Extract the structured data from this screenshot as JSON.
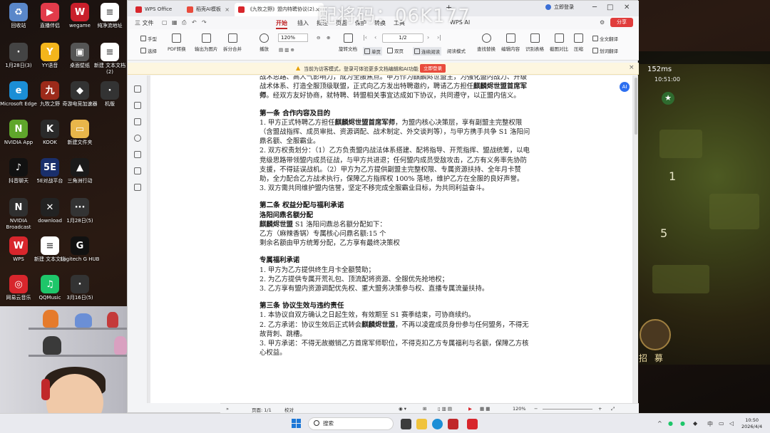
{
  "watermark": "配将码：06K177",
  "desktop_icons": [
    {
      "label": "回收站",
      "glyph": "♻",
      "color": "#5a87c9"
    },
    {
      "label": "直播伴侣",
      "glyph": "▶",
      "color": "#e23b4a"
    },
    {
      "label": "wegame",
      "glyph": "W",
      "color": "#c91f2b"
    },
    {
      "label": "纯净流地址",
      "glyph": "≡",
      "color": "#ffffff"
    },
    {
      "label": "1月28日(3)",
      "glyph": "·",
      "color": "#444444"
    },
    {
      "label": "YY语音",
      "glyph": "Y",
      "color": "#f3b51c"
    },
    {
      "label": "桌面壁纸",
      "glyph": "▣",
      "color": "#555555"
    },
    {
      "label": "新建 文本文档 (2)",
      "glyph": "≡",
      "color": "#ffffff"
    },
    {
      "label": "Microsoft Edge",
      "glyph": "e",
      "color": "#1b8ed6"
    },
    {
      "label": "九牧之野",
      "glyph": "九",
      "color": "#9c2a1a"
    },
    {
      "label": "奇游电竞加速器",
      "glyph": "◆",
      "color": "#333333"
    },
    {
      "label": "机版",
      "glyph": "·",
      "color": "#333333"
    },
    {
      "label": "NVIDIA App",
      "glyph": "N",
      "color": "#5fa62b"
    },
    {
      "label": "KOOK",
      "glyph": "K",
      "color": "#2a2a2a"
    },
    {
      "label": "新建文件夹",
      "glyph": "▭",
      "color": "#e9b64a"
    },
    {
      "label": "抖音聊天",
      "glyph": "♪",
      "color": "#111111"
    },
    {
      "label": "5E对战平台",
      "glyph": "5E",
      "color": "#1a2f6b"
    },
    {
      "label": "三角洲行动",
      "glyph": "▲",
      "color": "#1a1a1a"
    },
    {
      "label": "NVIDIA Broadcast",
      "glyph": "N",
      "color": "#2f2f2f"
    },
    {
      "label": "download",
      "glyph": "✕",
      "color": "#222222"
    },
    {
      "label": "1月28日(5)",
      "glyph": "···",
      "color": "#333333"
    },
    {
      "label": "WPS",
      "glyph": "W",
      "color": "#d8262c"
    },
    {
      "label": "新建 文本文档",
      "glyph": "≡",
      "color": "#ffffff"
    },
    {
      "label": "Logitech G HUB",
      "glyph": "G",
      "color": "#111111"
    },
    {
      "label": "网易云音乐",
      "glyph": "◎",
      "color": "#d7262c"
    },
    {
      "label": "QQMusic",
      "glyph": "♫",
      "color": "#1ec66a"
    },
    {
      "label": "3月16日(5)",
      "glyph": "·",
      "color": "#333333"
    }
  ],
  "game": {
    "ping": "152ms",
    "time": "10:51:00",
    "num_a": "1",
    "num_b": "5",
    "recruit": "招 募"
  },
  "wps": {
    "tabs": [
      {
        "label": "WPS Office",
        "color": "#d8262c"
      },
      {
        "label": "稻壳AI模板",
        "color": "#e94b3c"
      },
      {
        "label": "《九牧之野》盟内特聘协议(2)...",
        "color": "#d8262c"
      }
    ],
    "login": "立即登录",
    "share": "分享",
    "menus": [
      "三 文件",
      "开始",
      "插入",
      "批注",
      "页面",
      "保护",
      "转换",
      "工具",
      "WPS AI"
    ],
    "active_menu": "开始",
    "ribbon": {
      "hand": "手型",
      "select": "选择",
      "pdf_convert": "PDF转换",
      "export_image": "输出为图片",
      "split_merge": "拆分合并",
      "play": "播放",
      "zoom": "120%",
      "page": "1/2",
      "rotate": "旋转文档",
      "single": "单页",
      "double": "双页",
      "continuous": "连续阅读",
      "read_mode": "阅读模式",
      "find_replace": "查找替换",
      "edit_content": "编辑内容",
      "ocr_table": "识别表格",
      "screenshot_compare": "截图对比",
      "compress": "压缩",
      "full_translate": "全文翻译",
      "word_translate": "划词翻译"
    },
    "notice": {
      "text": "当前为访客模式，登录可体验更多文档编辑和AI功能",
      "button": "立即登录"
    },
    "status": {
      "page_info": "页面: 1/1",
      "proofread": "校对",
      "zoom": "120%"
    }
  },
  "document": {
    "intro_1": "战术思路、高人气影响力，成为全服焦点。甲方作为麒麟烬世盟主，为强化盟内战力、升级战术体系、打造全服顶级联盟，正式向乙方发出特聘邀约，聘请乙方担任",
    "intro_bold": "麒麟烬世盟首席军师",
    "intro_2": "。经双方友好协商，就特聘、转盟相关事宜达成如下协议，共同遵守，以正盟内信义。",
    "art1_title": "第一条 合作内容及目的",
    "art1_p1_a": "1. 甲方正式特聘乙方担任",
    "art1_p1_bold": "麒麟烬世盟首席军师",
    "art1_p1_b": "，为盟内核心决策层，享有副盟主完整权限（含盟战指挥、成员审批、资源调配、战术制定、外交谈判等），与甲方携手共争 S1 洛阳问鼎名额、全服霸业。",
    "art1_p2": "2. 双方权责划分：（1）乙方负责盟内战法体系搭建、配将指导、开荒指挥、盟战统筹，以电竞级思路带领盟内成员征战，与甲方共进退；任何盟内成员受敌攻击，乙方有义务率先协防支援，不得延误战机。（2）甲方为乙方提供副盟主完整权限、专属资源扶持、全年月卡赞助，全力配合乙方战术执行，保障乙方指挥权 100% 落地，维护乙方在全服的良好声誉。",
    "art1_p3": "3. 双方需共同维护盟内信誉，坚定不移完成全服霸业目标，为共同利益奋斗。",
    "art2_title": "第二条 权益分配与福利承诺",
    "art2_sub": "洛阳问鼎名额分配",
    "art2_line1_bold": "麒麟烬世盟",
    "art2_line1": " S1 洛阳问鼎总名额分配如下：",
    "art2_line2": "乙方（麻辣香锅）专属核心问鼎名额:15 个",
    "art2_line3": "剩余名额由甲方统筹分配，乙方享有最终决策权",
    "welfare_title": "专属福利承诺",
    "welfare_1": "1. 甲方为乙方提供终生月卡全额赞助；",
    "welfare_2": "2. 为乙方提供专属开荒礼包、顶流配将资源、全服优先抢地权；",
    "welfare_3": "3. 乙方享有盟内资源调配优先权、重大盟务决策参与权、直播专属流量扶持。",
    "art3_title": "第三条 协议生效与违约责任",
    "art3_p1": "1. 本协议自双方确认之日起生效，有效期至 S1 赛季结束，可协商续约。",
    "art3_p2_a": "2. 乙方承诺：协议生效后正式转会",
    "art3_p2_bold": "麒麟烬世盟",
    "art3_p2_b": "，不再以凌霆成员身份参与任何盟务，不得无故背刺、跳槽。",
    "art3_p3": "3. 甲方承诺：不得无故撤销乙方首席军师职位，不得克扣乙方专属福利与名额，保障乙方核心权益。"
  },
  "taskbar": {
    "search": "搜索",
    "lang": "中",
    "time": "10:50",
    "date": "2026/4/4"
  }
}
